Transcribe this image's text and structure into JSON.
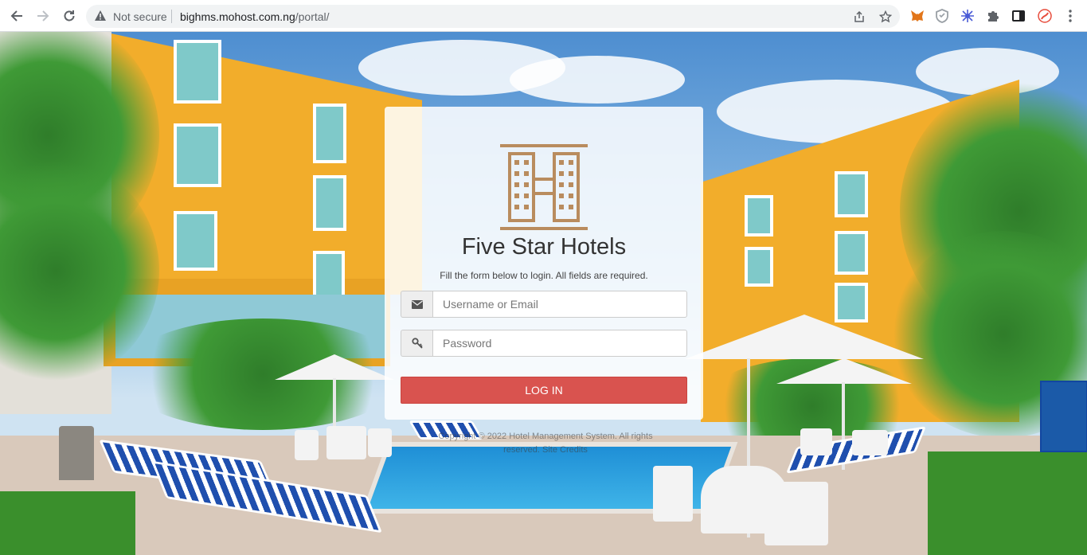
{
  "browser": {
    "security_label": "Not secure",
    "url_host": "bighms.mohost.com.ng",
    "url_path": "/portal/",
    "nav_icons": [
      "back-icon",
      "forward-icon",
      "reload-icon"
    ],
    "omnibox_icons": [
      "share-icon",
      "bookmark-star-icon"
    ],
    "extension_icons": [
      "metamask-fox-icon",
      "shield-extension-icon",
      "snowflake-extension-icon",
      "puzzle-extensions-icon",
      "side-panel-icon",
      "profile-icon",
      "menu-kebab-icon"
    ]
  },
  "login": {
    "brand_name": "Five Star Hotels",
    "instructions": "Fill the form below to login. All fields are required.",
    "username_placeholder": "Username or Email",
    "password_placeholder": "Password",
    "username_icon": "envelope-icon",
    "password_icon": "key-icon",
    "submit_label": "LOG IN",
    "submit_color": "#d9534f",
    "logo_color": "#b98c5e"
  },
  "footer": {
    "copyright": "Copyright © 2022 Hotel Management System. All rights reserved.",
    "link_label": "Site Credits"
  }
}
